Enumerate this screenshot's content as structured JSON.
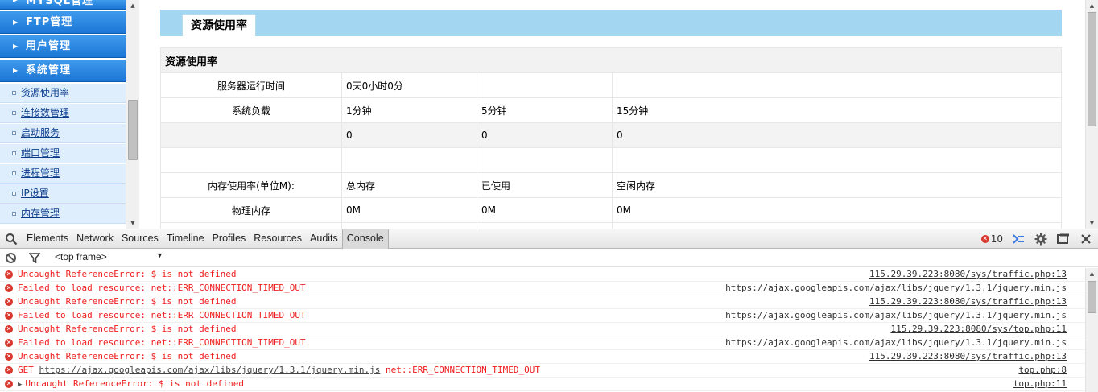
{
  "nav": {
    "menus": [
      {
        "label": "MYSQL管理"
      },
      {
        "label": "FTP管理"
      },
      {
        "label": "用户管理"
      },
      {
        "label": "系统管理"
      }
    ],
    "items": [
      {
        "label": "资源使用率"
      },
      {
        "label": "连接数管理"
      },
      {
        "label": "启动服务"
      },
      {
        "label": "端口管理"
      },
      {
        "label": "进程管理"
      },
      {
        "label": "IP设置"
      },
      {
        "label": "内存管理"
      }
    ]
  },
  "main": {
    "tab_label": "资源使用率",
    "table": {
      "caption": "资源使用率",
      "rows": [
        {
          "label": "服务器运行时间",
          "c1": "0天0小时0分",
          "c2": "",
          "c3": ""
        },
        {
          "label": "系统负载",
          "c1": "1分钟",
          "c2": "5分钟",
          "c3": "15分钟"
        },
        {
          "label": "",
          "c1": "0",
          "c2": "0",
          "c3": "0"
        },
        {
          "label": "",
          "c1": "",
          "c2": "",
          "c3": ""
        },
        {
          "label": "内存使用率(单位M):",
          "c1": "总内存",
          "c2": "已使用",
          "c3": "空闲内存"
        },
        {
          "label": "物理内存",
          "c1": "0M",
          "c2": "0M",
          "c3": "0M"
        }
      ]
    }
  },
  "devtools": {
    "tabs": [
      "Elements",
      "Network",
      "Sources",
      "Timeline",
      "Profiles",
      "Resources",
      "Audits",
      "Console"
    ],
    "active_tab": "Console",
    "error_count": "10",
    "frame_select": "<top frame>",
    "messages": [
      {
        "text": "Uncaught ReferenceError: $ is not defined",
        "source": "115.29.39.223:8080/sys/traffic.php:13",
        "source_link": true
      },
      {
        "text": "Failed to load resource: net::ERR_CONNECTION_TIMED_OUT",
        "source": "https://ajax.googleapis.com/ajax/libs/jquery/1.3.1/jquery.min.js",
        "source_link": false
      },
      {
        "text": "Uncaught ReferenceError: $ is not defined",
        "source": "115.29.39.223:8080/sys/traffic.php:13",
        "source_link": true
      },
      {
        "text": "Failed to load resource: net::ERR_CONNECTION_TIMED_OUT",
        "source": "https://ajax.googleapis.com/ajax/libs/jquery/1.3.1/jquery.min.js",
        "source_link": false
      },
      {
        "text": "Uncaught ReferenceError: $ is not defined",
        "source": "115.29.39.223:8080/sys/top.php:11",
        "source_link": true
      },
      {
        "text": "Failed to load resource: net::ERR_CONNECTION_TIMED_OUT",
        "source": "https://ajax.googleapis.com/ajax/libs/jquery/1.3.1/jquery.min.js",
        "source_link": false
      },
      {
        "text": "Uncaught ReferenceError: $ is not defined",
        "source": "115.29.39.223:8080/sys/traffic.php:13",
        "source_link": true
      }
    ],
    "get_message": {
      "method": "GET",
      "url": "https://ajax.googleapis.com/ajax/libs/jquery/1.3.1/jquery.min.js",
      "error": "net::ERR_CONNECTION_TIMED_OUT",
      "source": "top.php:8"
    },
    "last_message": {
      "text": "Uncaught ReferenceError: $ is not defined",
      "source": "top.php:11"
    }
  },
  "colors": {
    "nav_header": "#1b76d6",
    "tab_bar": "#a3d6f0",
    "error_red": "#ef1d1d"
  }
}
